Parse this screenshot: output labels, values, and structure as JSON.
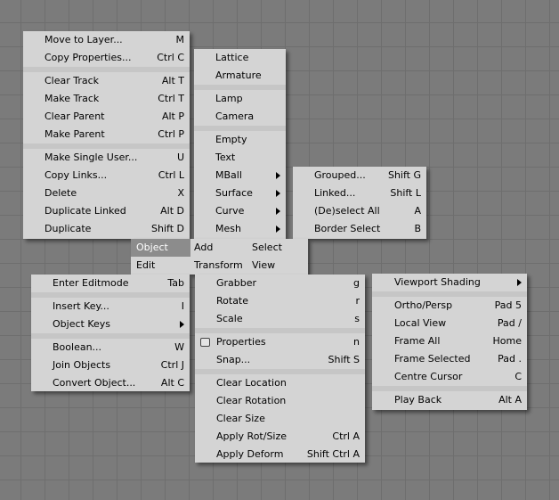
{
  "object_menu": {
    "items": [
      {
        "label": "Move to Layer...",
        "key": "M"
      },
      {
        "label": "Copy Properties...",
        "key": "Ctrl C"
      },
      {
        "label": "Clear Track",
        "key": "Alt T"
      },
      {
        "label": "Make Track",
        "key": "Ctrl T"
      },
      {
        "label": "Clear Parent",
        "key": "Alt P"
      },
      {
        "label": "Make Parent",
        "key": "Ctrl P"
      },
      {
        "label": "Make Single User...",
        "key": "U"
      },
      {
        "label": "Copy Links...",
        "key": "Ctrl L"
      },
      {
        "label": "Delete",
        "key": "X"
      },
      {
        "label": "Duplicate Linked",
        "key": "Alt D"
      },
      {
        "label": "Duplicate",
        "key": "Shift D"
      }
    ]
  },
  "add_menu": {
    "items": [
      {
        "label": "Lattice"
      },
      {
        "label": "Armature"
      },
      {
        "label": "Lamp"
      },
      {
        "label": "Camera"
      },
      {
        "label": "Empty"
      },
      {
        "label": "Text"
      },
      {
        "label": "MBall"
      },
      {
        "label": "Surface"
      },
      {
        "label": "Curve"
      },
      {
        "label": "Mesh"
      }
    ]
  },
  "select_menu": {
    "items": [
      {
        "label": "Grouped...",
        "key": "Shift G"
      },
      {
        "label": "Linked...",
        "key": "Shift L"
      },
      {
        "label": "(De)select All",
        "key": "A"
      },
      {
        "label": "Border Select",
        "key": "B"
      }
    ]
  },
  "header": {
    "row1": {
      "object": "Object",
      "add": "Add",
      "select": "Select"
    },
    "row2": {
      "edit": "Edit",
      "transform": "Transform",
      "view": "View"
    }
  },
  "edit_menu": {
    "items": [
      {
        "label": "Enter Editmode",
        "key": "Tab"
      },
      {
        "label": "Insert Key...",
        "key": "I"
      },
      {
        "label": "Object Keys"
      },
      {
        "label": "Boolean...",
        "key": "W"
      },
      {
        "label": "Join Objects",
        "key": "Ctrl J"
      },
      {
        "label": "Convert Object...",
        "key": "Alt C"
      }
    ]
  },
  "transform_menu": {
    "items": [
      {
        "label": "Grabber",
        "key": "g"
      },
      {
        "label": "Rotate",
        "key": "r"
      },
      {
        "label": "Scale",
        "key": "s"
      },
      {
        "label": "Properties",
        "key": "n"
      },
      {
        "label": "Snap...",
        "key": "Shift S"
      },
      {
        "label": "Clear Location"
      },
      {
        "label": "Clear Rotation"
      },
      {
        "label": "Clear Size"
      },
      {
        "label": "Apply Rot/Size",
        "key": "Ctrl A"
      },
      {
        "label": "Apply Deform",
        "key": "Shift Ctrl A"
      }
    ]
  },
  "view_menu": {
    "items": [
      {
        "label": "Viewport Shading"
      },
      {
        "label": "Ortho/Persp",
        "key": "Pad 5"
      },
      {
        "label": "Local View",
        "key": "Pad /"
      },
      {
        "label": "Frame All",
        "key": "Home"
      },
      {
        "label": "Frame Selected",
        "key": "Pad ."
      },
      {
        "label": "Centre Cursor",
        "key": "C"
      },
      {
        "label": "Play Back",
        "key": "Alt A"
      }
    ]
  }
}
